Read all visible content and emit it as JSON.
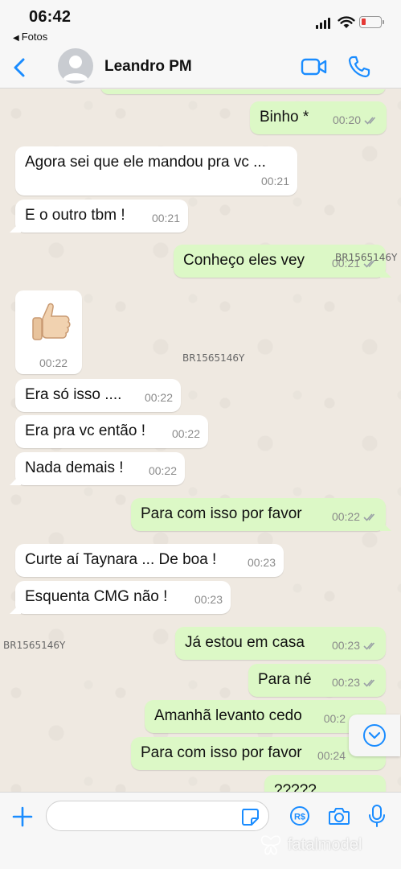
{
  "status_bar": {
    "time": "06:42",
    "back_app": "Fotos"
  },
  "header": {
    "contact_name": "Leandro PM"
  },
  "messages": [
    {
      "text": "Binho *",
      "time": "00:20"
    },
    {
      "text": "Agora sei que ele mandou pra vc ...",
      "time": "00:21"
    },
    {
      "text": "E o outro tbm !",
      "time": "00:21"
    },
    {
      "text": "Conheço eles vey",
      "time": "00:21"
    },
    {
      "text": "",
      "time": "00:22"
    },
    {
      "text": "Era só isso ....",
      "time": "00:22"
    },
    {
      "text": "Era pra vc então !",
      "time": "00:22"
    },
    {
      "text": "Nada demais !",
      "time": "00:22"
    },
    {
      "text": "Para com isso por favor",
      "time": "00:22"
    },
    {
      "text": "Curte aí Taynara ... De boa !",
      "time": "00:23"
    },
    {
      "text": "Esquenta CMG não !",
      "time": "00:23"
    },
    {
      "text": "Já estou em casa",
      "time": "00:23"
    },
    {
      "text": "Para né",
      "time": "00:23"
    },
    {
      "text": "Amanhã levanto cedo",
      "time": "00:2"
    },
    {
      "text": "Para com isso por favor",
      "time": "00:24"
    },
    {
      "text": "?????",
      "time": ""
    }
  ],
  "watermarks": {
    "code": "BR1565146Y",
    "brand": "fatalmodel"
  },
  "input": {
    "placeholder": ""
  },
  "colors": {
    "accent": "#1a8cff",
    "outgoing_bubble": "#dcf8c6",
    "incoming_bubble": "#ffffff",
    "battery_low": "#e53935"
  },
  "icons": [
    "back-chevron-icon",
    "video-call-icon",
    "phone-icon",
    "plus-icon",
    "sticker-icon",
    "payment-icon",
    "camera-icon",
    "microphone-icon",
    "chevron-down-icon",
    "double-check-icon",
    "thumbs-up-icon"
  ]
}
